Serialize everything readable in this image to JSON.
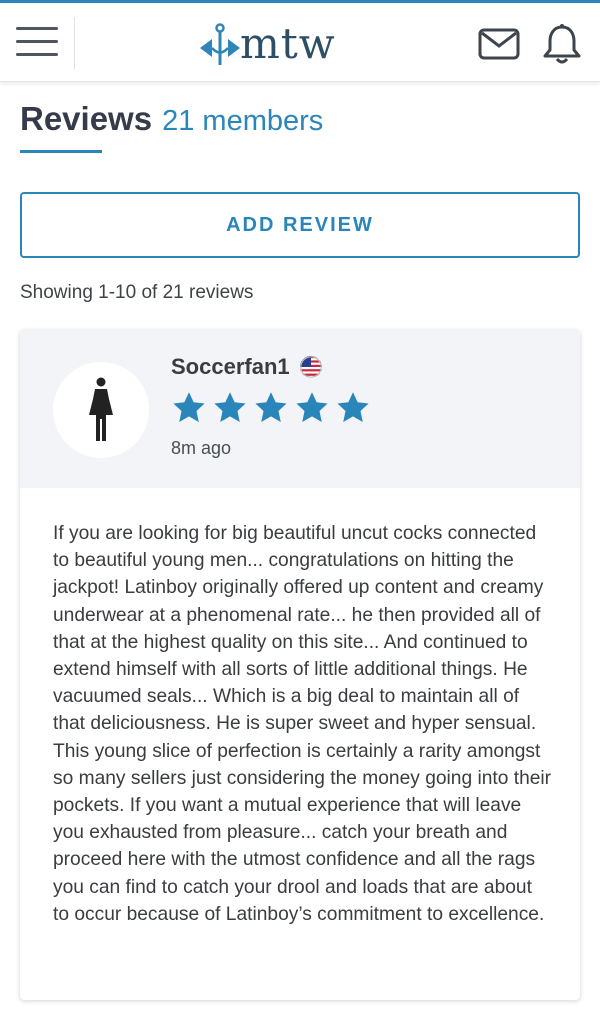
{
  "header": {
    "logo_text": "mtw",
    "icons": [
      "menu-icon",
      "logo-icon",
      "mail-icon",
      "bell-icon"
    ]
  },
  "page": {
    "title": "Reviews",
    "members": "21 members",
    "add_review_label": "ADD REVIEW",
    "showing_text": "Showing 1-10 of 21 reviews"
  },
  "review": {
    "author": "Soccerfan1",
    "country_flag_icon": "us-flag-icon",
    "rating": 5,
    "rating_max": 5,
    "time": "8m ago",
    "body": "If you are looking for big beautiful uncut cocks connected to beautiful young men... congratulations on hitting the jackpot! Latinboy originally offered up content and creamy underwear at a phenomenal rate... he then provided all of that at the highest quality on this site... And continued to extend himself with all sorts of little additional things. He vacuumed seals... Which is a big deal to maintain all of that deliciousness. He is super sweet and hyper sensual. This young slice of perfection is certainly a rarity amongst so many sellers just considering the money going into their pockets. If you want a mutual experience that will leave you exhausted from pleasure... catch your breath and proceed here with the utmost confidence and all the rags you can find to catch your drool and loads that are about to occur because of Latinboy’s commitment to excellence."
  },
  "colors": {
    "accent": "#2a86ba",
    "star": "#2a86ba",
    "title": "#363a4a",
    "card_header_bg": "#f2f4f7"
  }
}
